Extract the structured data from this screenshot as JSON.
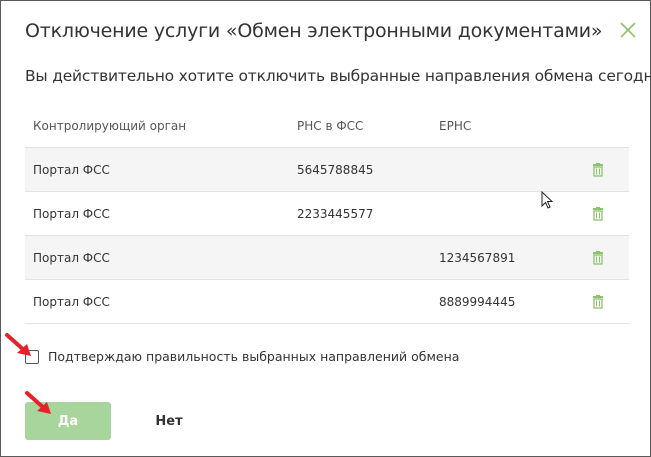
{
  "dialog": {
    "title": "Отключение услуги «Обмен электронными документами»",
    "question": "Вы действительно хотите отключить выбранные направления обмена сегодня?",
    "close_icon": "close-icon"
  },
  "table": {
    "headers": [
      "Контролирующий орган",
      "РНС в ФСС",
      "ЕРНС"
    ],
    "rows": [
      {
        "authority": "Портал ФСС",
        "rns": "5645788845",
        "erns": ""
      },
      {
        "authority": "Портал ФСС",
        "rns": "2233445577",
        "erns": ""
      },
      {
        "authority": "Портал ФСС",
        "rns": "",
        "erns": "1234567891"
      },
      {
        "authority": "Портал ФСС",
        "rns": "",
        "erns": "8889994445"
      }
    ],
    "row_action_icon": "trash-icon"
  },
  "confirm": {
    "label": "Подтверждаю правильность выбранных направлений обмена",
    "checked": false
  },
  "buttons": {
    "yes": "Да",
    "no": "Нет"
  },
  "colors": {
    "accent_green": "#8dc26f",
    "yes_button_disabled": "#a8d59c",
    "annotation_arrow": "#e8202a"
  }
}
